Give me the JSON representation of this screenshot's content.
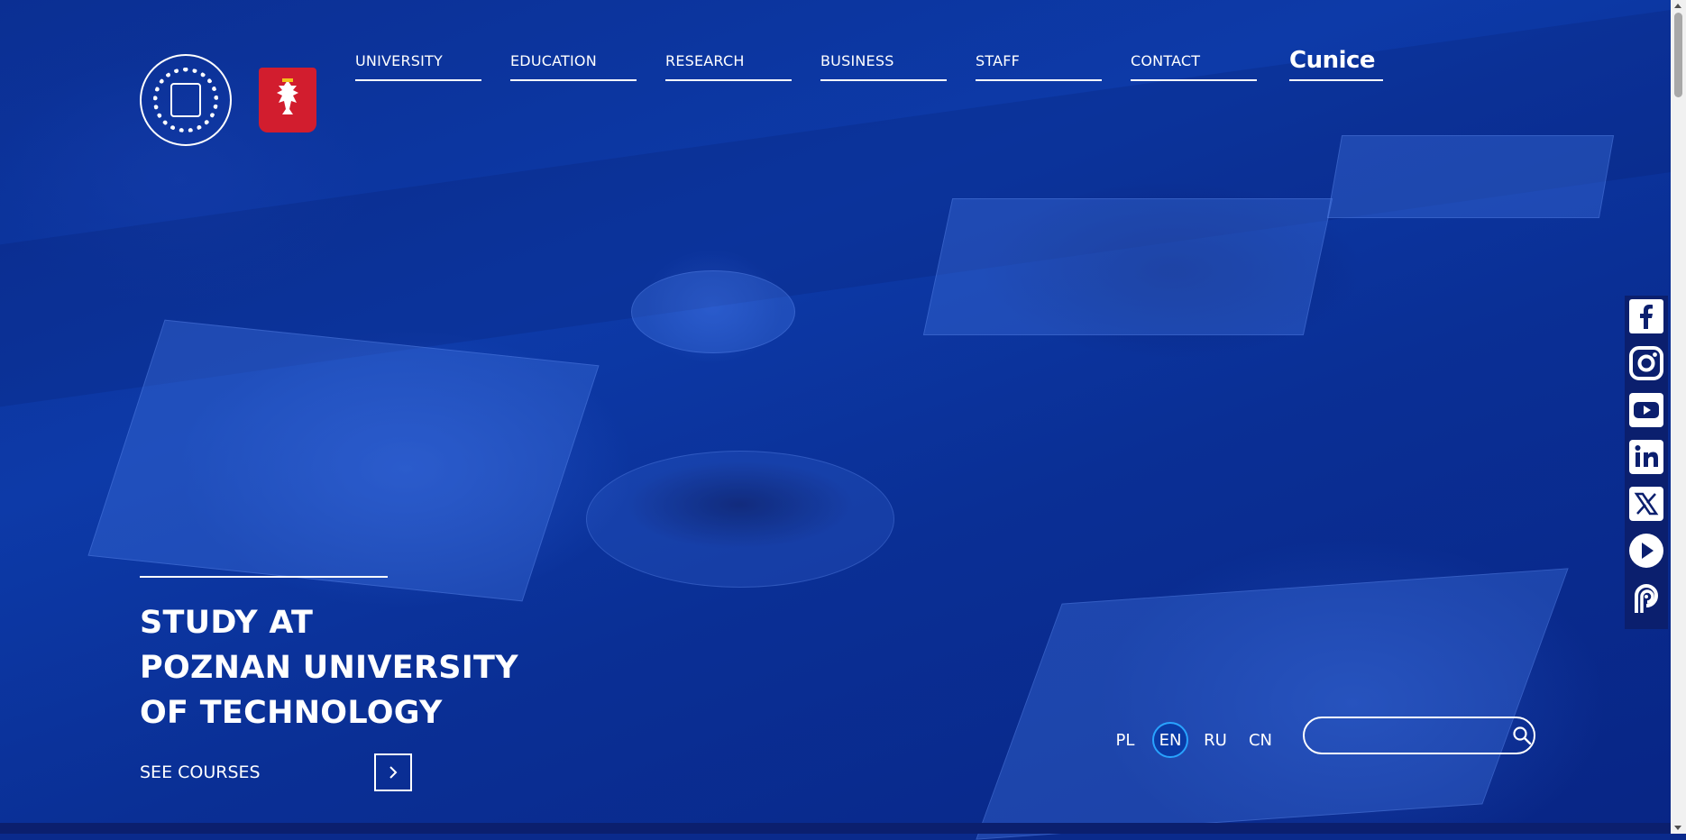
{
  "header": {
    "logo_alt": "Poznan University of Technology",
    "emblem_alt": "Coat of arms of Poland",
    "nav": [
      {
        "label": "UNIVERSITY"
      },
      {
        "label": "EDUCATION"
      },
      {
        "label": "RESEARCH"
      },
      {
        "label": "BUSINESS"
      },
      {
        "label": "STAFF"
      },
      {
        "label": "CONTACT"
      }
    ],
    "unice_label": "Cunice"
  },
  "hero": {
    "title_lines": [
      "STUDY AT",
      "POZNAN UNIVERSITY",
      "OF TECHNOLOGY"
    ],
    "cta_label": "SEE COURSES"
  },
  "languages": {
    "items": [
      "PL",
      "EN",
      "RU",
      "CN"
    ],
    "active": "EN"
  },
  "search": {
    "placeholder": "",
    "value": ""
  },
  "social_icons": [
    "facebook-icon",
    "instagram-icon",
    "youtube-icon",
    "linkedin-icon",
    "x-icon",
    "play-icon",
    "podcast-icon"
  ],
  "colors": {
    "brand_blue": "#0b2f93",
    "active_lang_ring": "#29a3ff",
    "emblem_red": "#d21d2e"
  }
}
